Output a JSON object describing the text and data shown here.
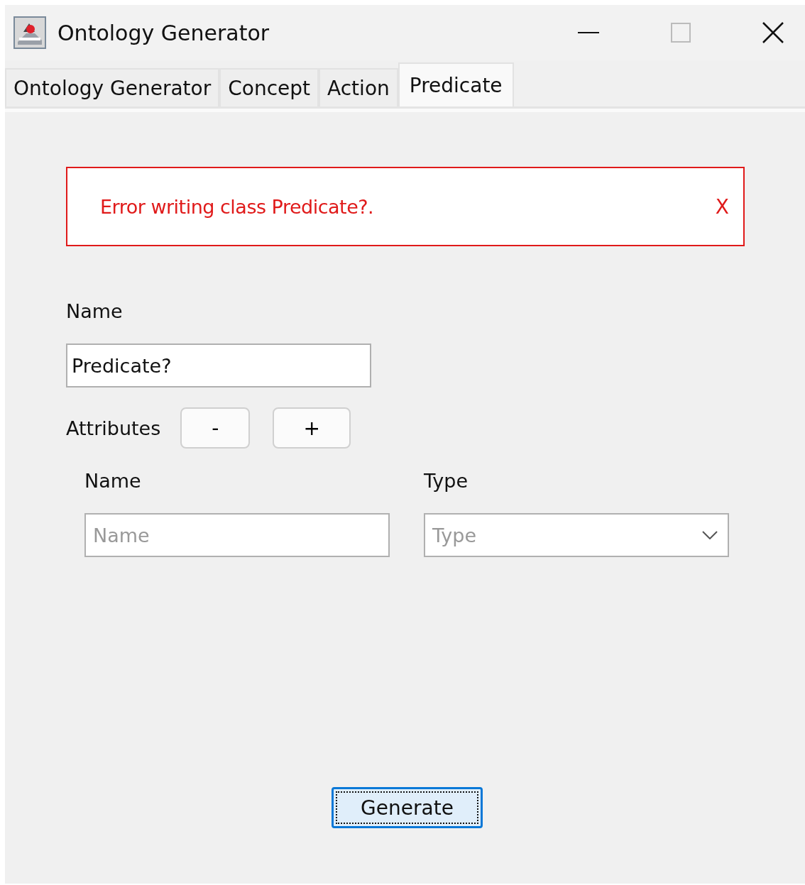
{
  "window": {
    "title": "Ontology Generator"
  },
  "tabs": [
    {
      "label": "Ontology Generator",
      "selected": false
    },
    {
      "label": "Concept",
      "selected": false
    },
    {
      "label": "Action",
      "selected": false
    },
    {
      "label": "Predicate",
      "selected": true
    }
  ],
  "error": {
    "message": "Error writing class Predicate?.",
    "close": "X"
  },
  "name_field": {
    "label": "Name",
    "value": "Predicate?"
  },
  "attributes": {
    "label": "Attributes",
    "buttons": [
      "-",
      "+"
    ],
    "columns": [
      {
        "label": "Name",
        "kind": "text",
        "placeholder": "Name"
      },
      {
        "label": "Type",
        "kind": "dropdown",
        "placeholder": "Type"
      }
    ]
  },
  "generate_button": {
    "label": "Generate"
  }
}
